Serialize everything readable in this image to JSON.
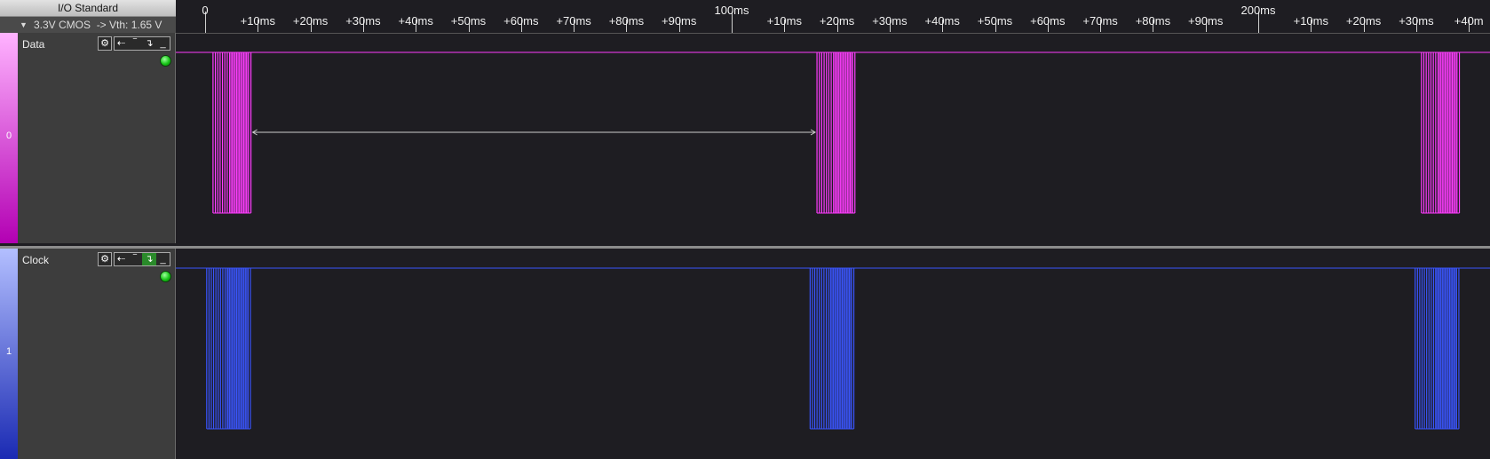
{
  "header": {
    "io_standard_label": "I/O Standard",
    "io_setting": "3.3V CMOS  -> Vth: 1.65 V"
  },
  "ruler": {
    "ticks": [
      {
        "label": "0",
        "major": true
      },
      {
        "label": "+10ms"
      },
      {
        "label": "+20ms"
      },
      {
        "label": "+30ms"
      },
      {
        "label": "+40ms"
      },
      {
        "label": "+50ms"
      },
      {
        "label": "+60ms"
      },
      {
        "label": "+70ms"
      },
      {
        "label": "+80ms"
      },
      {
        "label": "+90ms"
      },
      {
        "label": "100ms",
        "major": true
      },
      {
        "label": "+10ms"
      },
      {
        "label": "+20ms"
      },
      {
        "label": "+30ms"
      },
      {
        "label": "+40ms"
      },
      {
        "label": "+50ms"
      },
      {
        "label": "+60ms"
      },
      {
        "label": "+70ms"
      },
      {
        "label": "+80ms"
      },
      {
        "label": "+90ms"
      },
      {
        "label": "200ms",
        "major": true
      },
      {
        "label": "+10ms"
      },
      {
        "label": "+20ms"
      },
      {
        "label": "+30ms"
      },
      {
        "label": "+40m"
      }
    ]
  },
  "channels": [
    {
      "number": "0",
      "name": "Data",
      "color": "#ff3cff",
      "gutter_colors": [
        "#ffb3ff",
        "#b300b3"
      ],
      "settings_icon": "gear-icon",
      "trigger_icons": [
        "rising-edge-icon",
        "high-level-icon",
        "falling-edge-icon",
        "low-level-icon"
      ],
      "active_trigger": null,
      "status_led": "green",
      "bursts": [
        {
          "start_ms": 1.5,
          "end_ms": 8.7
        },
        {
          "start_ms": 116.2,
          "end_ms": 123.4
        },
        {
          "start_ms": 231.0,
          "end_ms": 238.2
        }
      ]
    },
    {
      "number": "1",
      "name": "Clock",
      "color": "#3a55ff",
      "gutter_colors": [
        "#b3bfff",
        "#1a2ab3"
      ],
      "settings_icon": "gear-icon",
      "trigger_icons": [
        "rising-edge-icon",
        "high-level-icon",
        "falling-edge-icon",
        "low-level-icon"
      ],
      "active_trigger": "falling-edge-icon",
      "status_led": "green",
      "bursts": [
        {
          "start_ms": 0.3,
          "end_ms": 8.6
        },
        {
          "start_ms": 114.9,
          "end_ms": 123.2
        },
        {
          "start_ms": 229.8,
          "end_ms": 238.1
        }
      ]
    }
  ],
  "measurement": {
    "channel": "Data",
    "from_ms": 8.7,
    "to_ms": 116.2
  }
}
